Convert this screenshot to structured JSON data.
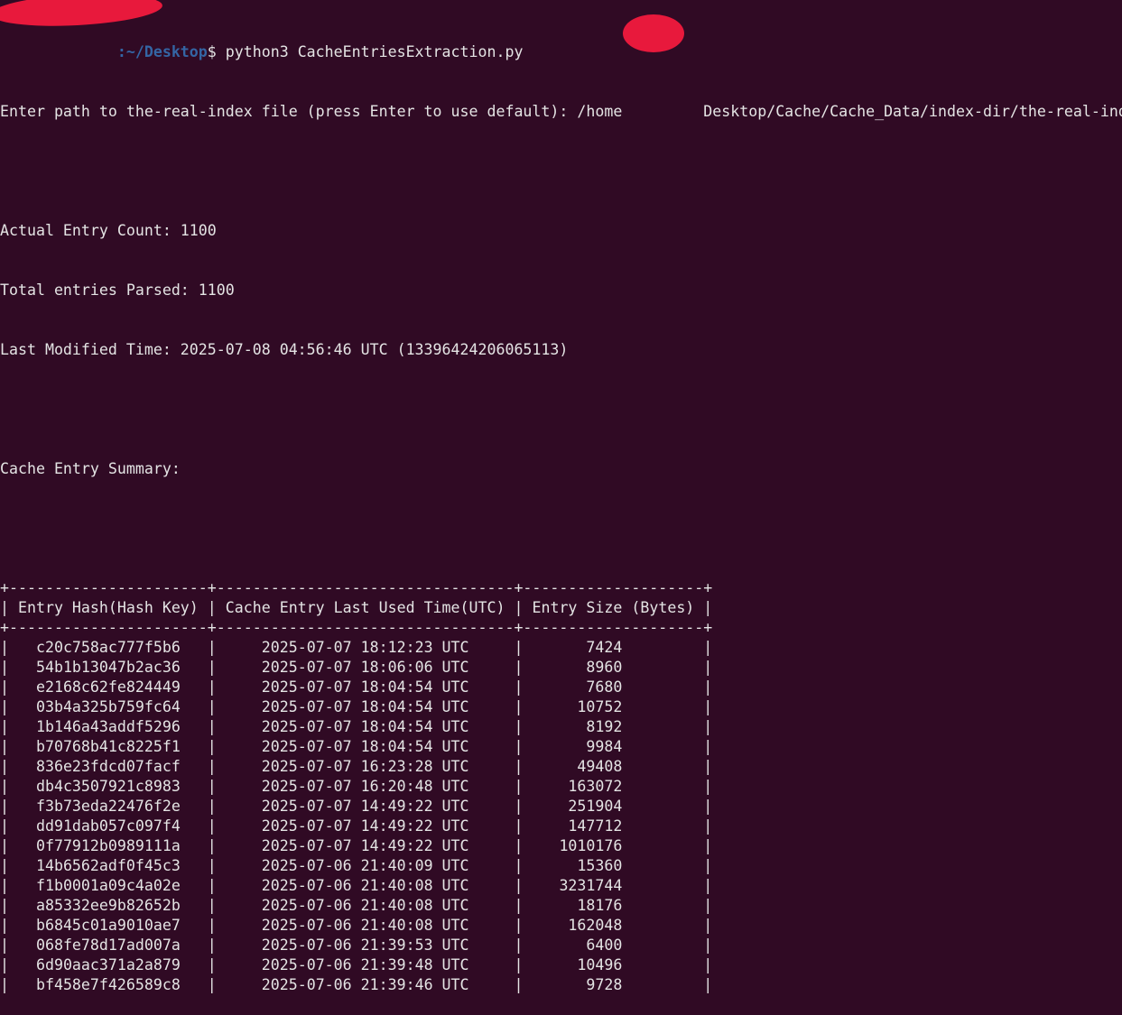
{
  "prompt": {
    "path": ":~/Desktop",
    "symbol": "$ ",
    "command": "python3 CacheEntriesExtraction.py"
  },
  "input_prompt": {
    "label": "Enter path to the-real-index file (press Enter to use default): ",
    "path_start": "/home",
    "path_rest": "Desktop/Cache/Cache_Data/index-dir/the-real-index"
  },
  "stats": {
    "actual_count": "Actual Entry Count: 1100",
    "total_parsed": "Total entries Parsed: 1100",
    "last_modified": "Last Modified Time: 2025-07-08 04:56:46 UTC (13396424206065113)"
  },
  "summary_title": "Cache Entry Summary:",
  "table": {
    "headers": [
      "Entry Hash(Hash Key)",
      "Cache Entry Last Used Time(UTC)",
      "Entry Size (Bytes)"
    ],
    "rows": [
      [
        "c20c758ac777f5b6",
        "2025-07-07 18:12:23 UTC",
        "7424"
      ],
      [
        "54b1b13047b2ac36",
        "2025-07-07 18:06:06 UTC",
        "8960"
      ],
      [
        "e2168c62fe824449",
        "2025-07-07 18:04:54 UTC",
        "7680"
      ],
      [
        "03b4a325b759fc64",
        "2025-07-07 18:04:54 UTC",
        "10752"
      ],
      [
        "1b146a43addf5296",
        "2025-07-07 18:04:54 UTC",
        "8192"
      ],
      [
        "b70768b41c8225f1",
        "2025-07-07 18:04:54 UTC",
        "9984"
      ],
      [
        "836e23fdcd07facf",
        "2025-07-07 16:23:28 UTC",
        "49408"
      ],
      [
        "db4c3507921c8983",
        "2025-07-07 16:20:48 UTC",
        "163072"
      ],
      [
        "f3b73eda22476f2e",
        "2025-07-07 14:49:22 UTC",
        "251904"
      ],
      [
        "dd91dab057c097f4",
        "2025-07-07 14:49:22 UTC",
        "147712"
      ],
      [
        "0f77912b0989111a",
        "2025-07-07 14:49:22 UTC",
        "1010176"
      ],
      [
        "14b6562adf0f45c3",
        "2025-07-06 21:40:09 UTC",
        "15360"
      ],
      [
        "f1b0001a09c4a02e",
        "2025-07-06 21:40:08 UTC",
        "3231744"
      ],
      [
        "a85332ee9b82652b",
        "2025-07-06 21:40:08 UTC",
        "18176"
      ],
      [
        "b6845c01a9010ae7",
        "2025-07-06 21:40:08 UTC",
        "162048"
      ],
      [
        "068fe78d17ad007a",
        "2025-07-06 21:39:53 UTC",
        "6400"
      ],
      [
        "6d90aac371a2a879",
        "2025-07-06 21:39:48 UTC",
        "10496"
      ],
      [
        "bf458e7f426589c8",
        "2025-07-06 21:39:46 UTC",
        "9728"
      ]
    ]
  },
  "colors": {
    "background": "#300a24",
    "text": "#e4e4e4",
    "path": "#3465a4",
    "redaction": "#e8193c"
  }
}
